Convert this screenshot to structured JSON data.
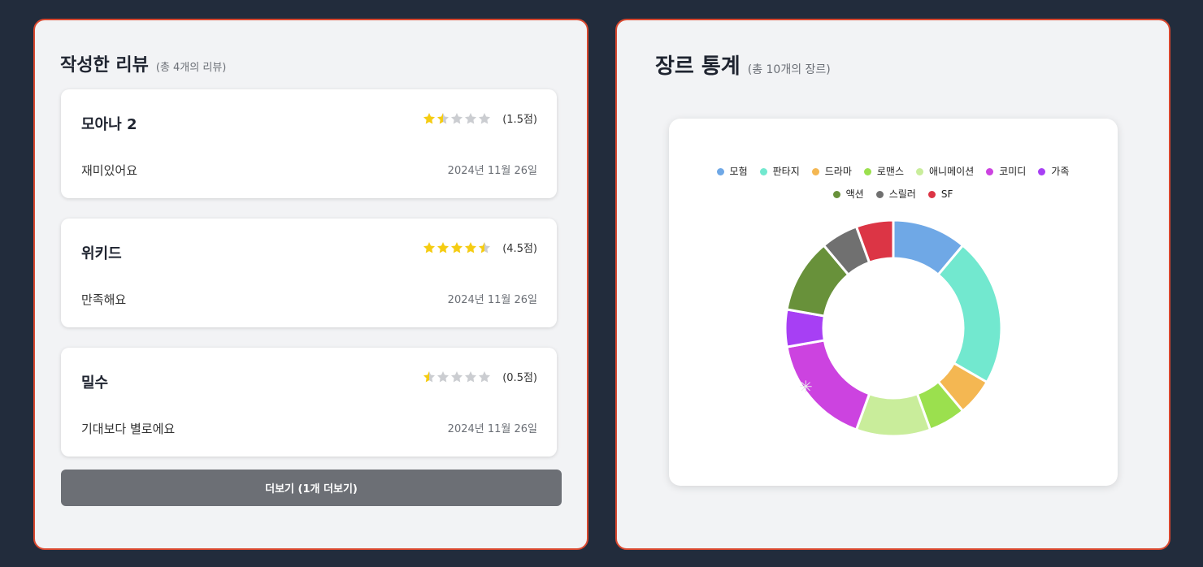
{
  "reviews": {
    "title": "작성한 리뷰",
    "subtitle": "(총 4개의 리뷰)",
    "items": [
      {
        "title": "모아나 2",
        "rating": 1.5,
        "score_label": "(1.5점)",
        "comment": "재미있어요",
        "date": "2024년 11월 26일"
      },
      {
        "title": "위키드",
        "rating": 4.5,
        "score_label": "(4.5점)",
        "comment": "만족해요",
        "date": "2024년 11월 26일"
      },
      {
        "title": "밀수",
        "rating": 0.5,
        "score_label": "(0.5점)",
        "comment": "기대보다 별로에요",
        "date": "2024년 11월 26일"
      }
    ],
    "more_label": "더보기 (1개 더보기)",
    "star_colors": {
      "filled": "#f5cc12",
      "empty": "#cbcdd1"
    }
  },
  "stats": {
    "title": "장르 통계",
    "subtitle": "(총 10개의 장르)"
  },
  "chart_data": {
    "type": "pie",
    "variant": "doughnut",
    "legend_position": "top",
    "categories": [
      "모험",
      "판타지",
      "드라마",
      "로맨스",
      "애니메이션",
      "코미디",
      "가족",
      "액션",
      "스릴러",
      "SF"
    ],
    "values": [
      2,
      4,
      1,
      1,
      2,
      3,
      1,
      2,
      1,
      1
    ],
    "colors": [
      "#6fa8e6",
      "#72e8cf",
      "#f4b752",
      "#9be04e",
      "#c9ed9b",
      "#cc43e0",
      "#a73ff4",
      "#68913a",
      "#707070",
      "#dc3545"
    ]
  }
}
